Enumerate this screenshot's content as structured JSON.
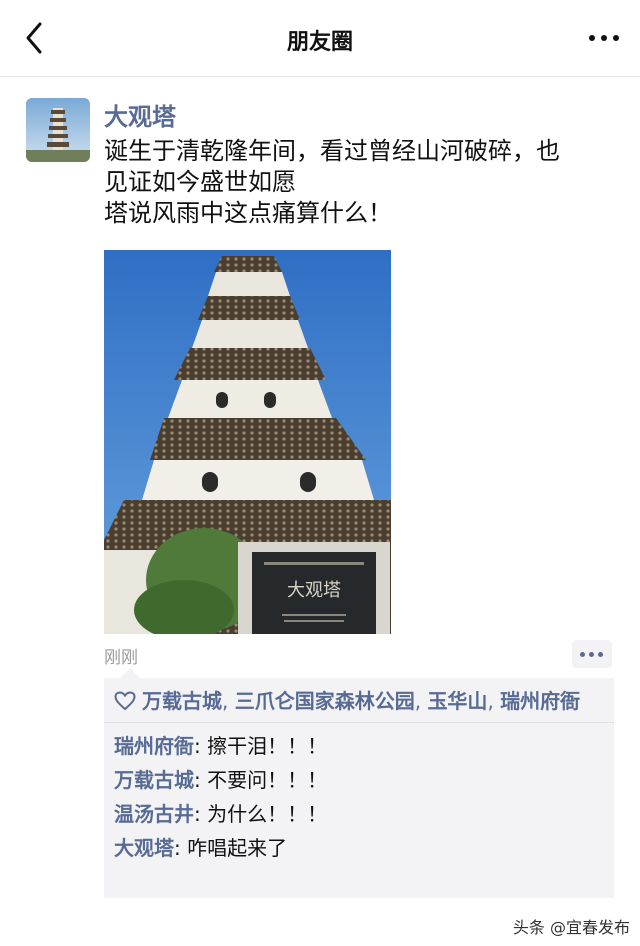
{
  "header": {
    "title": "朋友圈",
    "back_icon": "chevron-left-icon",
    "more_icon": "ellipsis-icon"
  },
  "post": {
    "author": "大观塔",
    "text_lines": [
      "诞生于清乾隆年间，看过曾经山河破碎，也",
      "见证如今盛世如愿",
      "塔说风雨中这点痛算什么！"
    ],
    "plaque_title": "大观塔",
    "timestamp": "刚刚"
  },
  "likes": {
    "icon": "heart-icon",
    "names": [
      "万载古城",
      "三爪仑国家森林公园",
      "玉华山",
      "瑞州府衙"
    ],
    "separator": ", "
  },
  "comments": [
    {
      "name": "瑞州府衙",
      "text": ": 擦干泪！！！"
    },
    {
      "name": "万载古城",
      "text": ": 不要问！！！"
    },
    {
      "name": "温汤古井",
      "text": ": 为什么！！！"
    },
    {
      "name": "大观塔",
      "text": ": 咋唱起来了"
    }
  ],
  "watermark": "头条 @宜春发布",
  "colors": {
    "link": "#576b95",
    "panel": "#f3f3f5",
    "sky": "#3f7fd0"
  }
}
